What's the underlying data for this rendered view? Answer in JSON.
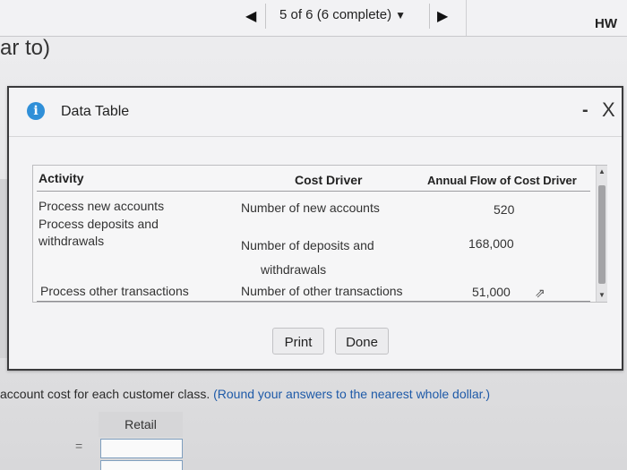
{
  "topbar": {
    "prev_arrow": "◀",
    "status": "5 of 6 (6 complete)",
    "status_caret": "▼",
    "next_arrow": "▶",
    "hw_label": "HW"
  },
  "background": {
    "partial_text": "ar to)"
  },
  "dialog": {
    "info_glyph": "i",
    "title": "Data Table",
    "minimize": "-",
    "close": "X",
    "table": {
      "headers": {
        "activity": "Activity",
        "cost_driver": "Cost Driver",
        "annual_flow": "Annual Flow of Cost Driver"
      },
      "rows": [
        {
          "activity": "Process new accounts",
          "cost_driver": "Number of new accounts",
          "annual_flow": "520"
        },
        {
          "activity": "Process deposits and withdrawals",
          "cost_driver_line1": "Number of deposits and",
          "cost_driver_line2": "withdrawals",
          "annual_flow": "168,000"
        },
        {
          "activity": "Process other transactions",
          "cost_driver": "Number of other transactions",
          "annual_flow": "51,000"
        }
      ]
    },
    "buttons": {
      "print": "Print",
      "done": "Done"
    }
  },
  "question": {
    "text": "account cost for each customer class.",
    "hint": "(Round your answers to the nearest whole dollar.)",
    "column_header": "Retail",
    "eq": "="
  },
  "colors": {
    "info_icon": "#2f8fd8",
    "hint_text": "#1e5aa8",
    "dialog_border": "#3a3a3c"
  }
}
